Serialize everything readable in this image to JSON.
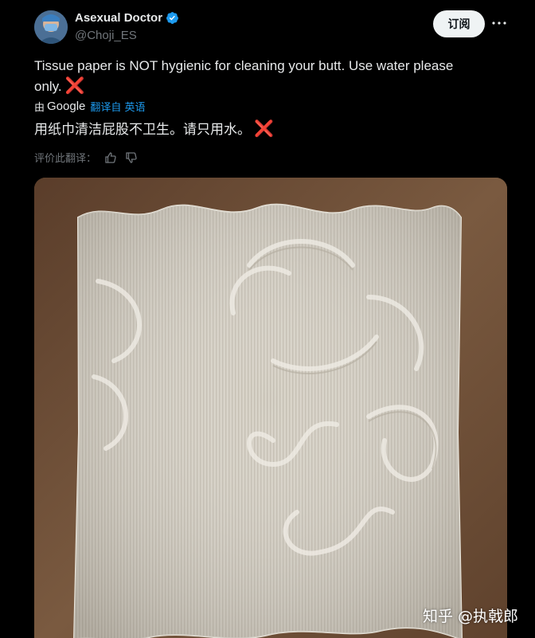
{
  "post": {
    "author": {
      "display_name": "Asexual Doctor",
      "handle": "@Choji_ES",
      "verified": true
    },
    "subscribe_label": "订阅",
    "more_icon": "more-horizontal-icon",
    "text": "Tissue paper is NOT hygienic for cleaning your butt. Use water please only.",
    "text_emoji": "❌",
    "translation": {
      "by_prefix": "由",
      "by_provider": "Google",
      "translated_from_label": "翻译自 英语",
      "text": "用纸巾清洁屁股不卫生。请只用水。",
      "text_emoji": "❌"
    },
    "rate_translation_label": "评价此翻译：",
    "image_alt_icon": "tissue-paper-photo"
  },
  "watermark": {
    "text": "知乎 @执戟郎"
  },
  "colors": {
    "background": "#000000",
    "text_primary": "#e7e9ea",
    "text_secondary": "#71767b",
    "accent_blue": "#1d9bf0",
    "x_red": "#f4212e",
    "button_bg": "#eff3f4"
  }
}
